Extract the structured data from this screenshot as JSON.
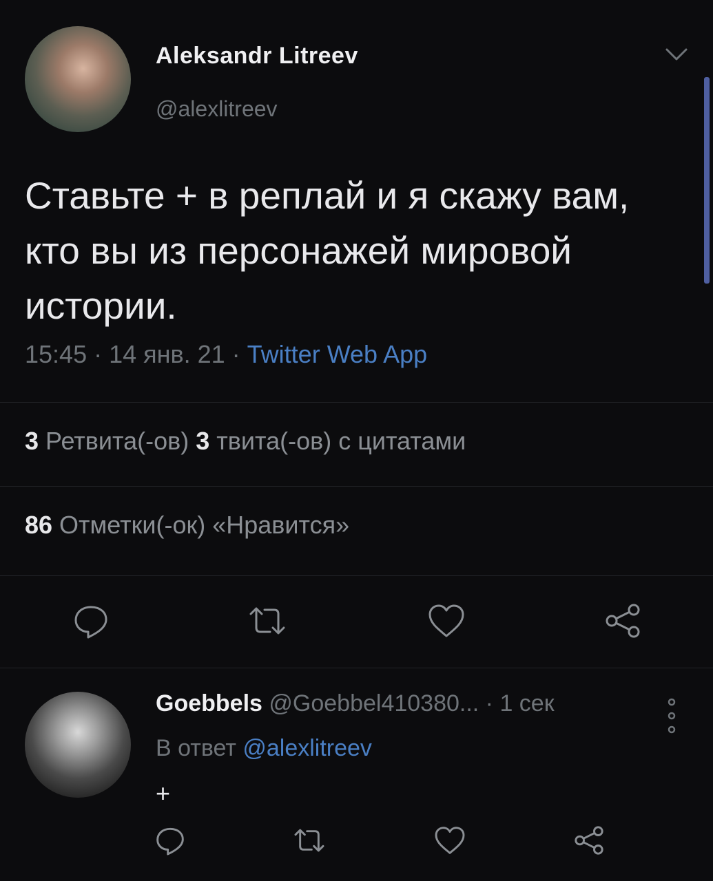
{
  "tweet": {
    "author_name": "Aleksandr Litreev",
    "author_handle": "@alexlitreev",
    "text": "Ставьте + в реплай и я скажу вам, кто вы из  персонажей мировой истории.",
    "time": "15:45 · 14 янв. 21 · ",
    "source": "Twitter Web App",
    "retweets_count": "3",
    "retweets_label": " Ретвита(-ов)  ",
    "quotes_count": "3",
    "quotes_label": " твита(-ов) с цитатами",
    "likes_count": "86",
    "likes_label": " Отметки(-ок) «Нравится»"
  },
  "reply": {
    "author_name": "Goebbels",
    "author_handle": " @Goebbel410380...  · 1 сек",
    "reply_prefix": "В ответ ",
    "reply_to": "@alexlitreev",
    "text": "+"
  },
  "icons": {
    "comment": "comment-icon",
    "retweet": "retweet-icon",
    "like": "heart-icon",
    "share": "share-icon",
    "chevron": "chevron-down-icon",
    "more": "more-vertical-icon"
  },
  "colors": {
    "background": "#0c0c0e",
    "link": "#4a7fc4",
    "muted": "#6f7479",
    "scrollbar": "#4f5fa0"
  }
}
